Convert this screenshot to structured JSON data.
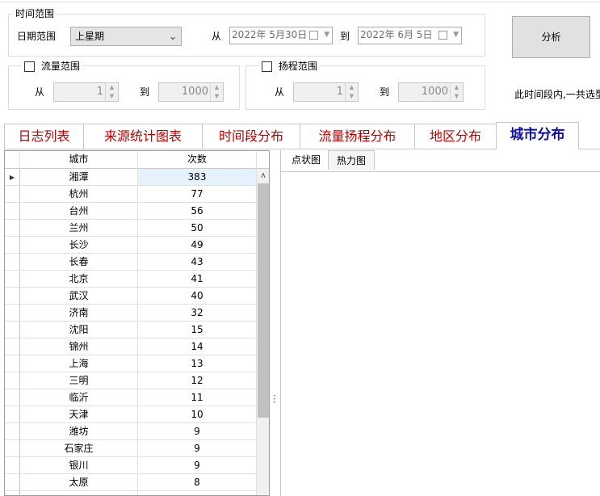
{
  "filters": {
    "time_group_title": "时间范围",
    "date_range_label": "日期范围",
    "date_range_value": "上星期",
    "from_label": "从",
    "to_label": "到",
    "date_from": "2022年  5月30日",
    "date_to": "2022年  6月  5日",
    "flow_group_title": "流量范围",
    "flow_from_label": "从",
    "flow_to_label": "到",
    "flow_from": "1",
    "flow_to": "1000",
    "head_group_title": "扬程范围",
    "head_from_label": "从",
    "head_to_label": "到",
    "head_from": "1",
    "head_to": "1000"
  },
  "actions": {
    "analyze_label": "分析",
    "summary_text": "此时间段内,一共选型"
  },
  "tabs": [
    {
      "label": "日志列表",
      "active": false
    },
    {
      "label": "来源统计图表",
      "active": false
    },
    {
      "label": "时间段分布",
      "active": false
    },
    {
      "label": "流量扬程分布",
      "active": false
    },
    {
      "label": "地区分布",
      "active": false
    },
    {
      "label": "城市分布",
      "active": true
    }
  ],
  "table": {
    "columns": [
      "城市",
      "次数"
    ],
    "rows": [
      {
        "city": "湘潭",
        "count": "383",
        "selected": true
      },
      {
        "city": "杭州",
        "count": "77"
      },
      {
        "city": "台州",
        "count": "56"
      },
      {
        "city": "兰州",
        "count": "50"
      },
      {
        "city": "长沙",
        "count": "49"
      },
      {
        "city": "长春",
        "count": "43"
      },
      {
        "city": "北京",
        "count": "41"
      },
      {
        "city": "武汉",
        "count": "40"
      },
      {
        "city": "济南",
        "count": "32"
      },
      {
        "city": "沈阳",
        "count": "15"
      },
      {
        "city": "锦州",
        "count": "14"
      },
      {
        "city": "上海",
        "count": "13"
      },
      {
        "city": "三明",
        "count": "12"
      },
      {
        "city": "临沂",
        "count": "11"
      },
      {
        "city": "天津",
        "count": "10"
      },
      {
        "city": "潍坊",
        "count": "9"
      },
      {
        "city": "石家庄",
        "count": "9"
      },
      {
        "city": "银川",
        "count": "9"
      },
      {
        "city": "太原",
        "count": "8"
      },
      {
        "city": "",
        "count": ""
      }
    ]
  },
  "chart_tabs": [
    {
      "label": "点状图",
      "active": true
    },
    {
      "label": "热力图",
      "active": false
    }
  ],
  "colors": {
    "tab_text": "#c00000",
    "active_tab_text": "#1010a0",
    "selected_cell": "#e5f1fb"
  }
}
